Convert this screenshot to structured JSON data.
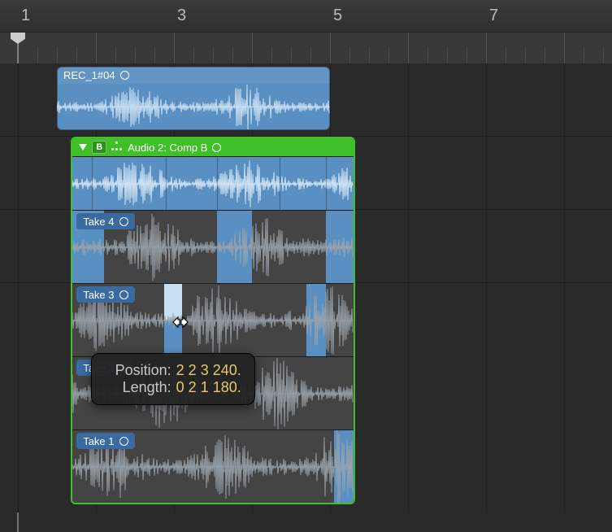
{
  "ruler": {
    "bar_labels": [
      "1",
      "3",
      "5",
      "7"
    ],
    "bars_visible": 8,
    "start_bar": 1
  },
  "playhead_bar": 1.0,
  "region1": {
    "name": "REC_1#04",
    "start_bar": 1.5,
    "end_bar": 5.0
  },
  "take_folder": {
    "start_bar": 1.7,
    "end_bar": 5.3,
    "comp_label": "Audio 2: Comp B",
    "controls": {
      "b_badge": "B"
    },
    "comp_sections": [
      {
        "start": 1.7,
        "end": 1.95
      },
      {
        "start": 1.95,
        "end": 2.9
      },
      {
        "start": 2.9,
        "end": 3.55
      },
      {
        "start": 3.55,
        "end": 4.35
      },
      {
        "start": 4.35,
        "end": 4.95
      },
      {
        "start": 4.95,
        "end": 5.3
      }
    ],
    "takes": [
      {
        "name": "Take 4",
        "selections": [
          [
            1.7,
            2.1
          ],
          [
            3.55,
            4.0
          ],
          [
            4.95,
            5.3
          ]
        ],
        "light": []
      },
      {
        "name": "Take 3",
        "selections": [
          [
            2.88,
            3.1
          ],
          [
            4.7,
            4.95
          ]
        ],
        "light": [
          [
            2.88,
            3.1
          ]
        ]
      },
      {
        "name": "Take 2",
        "selections": [],
        "light": []
      },
      {
        "name": "Take 1",
        "selections": [
          [
            5.05,
            5.3
          ]
        ],
        "light": []
      }
    ]
  },
  "cursor": {
    "bar": 3.08,
    "take_index": 1,
    "y_frac": 0.55
  },
  "tooltip": {
    "position_label": "Position:",
    "position_value": "2 2 3 240.",
    "length_label": "Length:",
    "length_value": "0 2 1 180."
  },
  "colors": {
    "accent_blue": "#5a8fc1",
    "folder_green": "#3fbf2a",
    "tooltip_value": "#e8c96a"
  }
}
